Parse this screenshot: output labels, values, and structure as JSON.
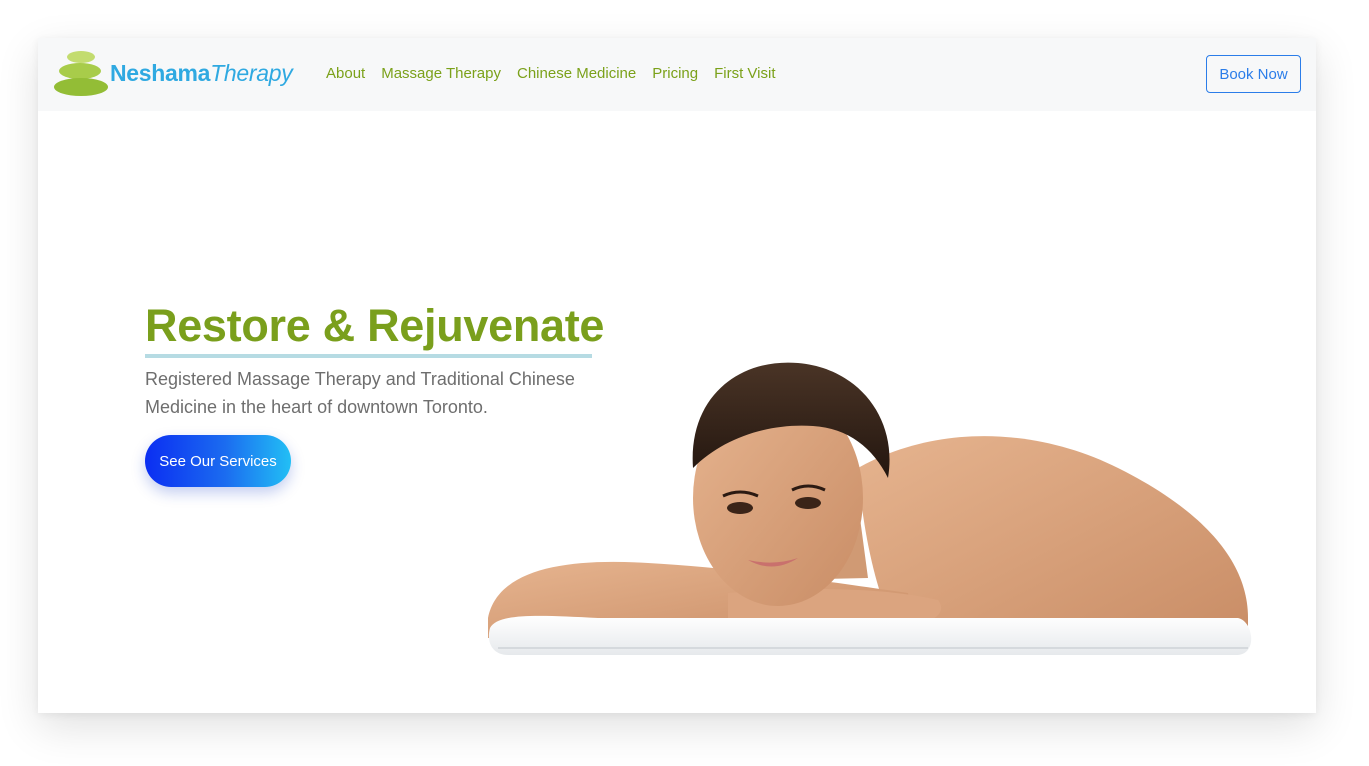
{
  "brand": {
    "name_part1": "Neshama",
    "name_part2": "Therapy",
    "stone_colors": [
      "#c3dc6f",
      "#a8cc4a",
      "#93bd36"
    ],
    "text_color": "#2fa9e1"
  },
  "nav": {
    "links": [
      {
        "label": "About"
      },
      {
        "label": "Massage Therapy"
      },
      {
        "label": "Chinese Medicine"
      },
      {
        "label": "Pricing"
      },
      {
        "label": "First Visit"
      }
    ],
    "link_color": "#7ba11a",
    "book_button": {
      "label": "Book Now",
      "color": "#2b7de9"
    }
  },
  "hero": {
    "title": "Restore & Rejuvenate",
    "subtitle": "Registered Massage Therapy and Traditional Chinese Medicine in the heart of downtown Toronto.",
    "cta_label": "See Our Services",
    "title_color": "#7a9f1c",
    "image_subject": "woman-resting-on-towel"
  }
}
